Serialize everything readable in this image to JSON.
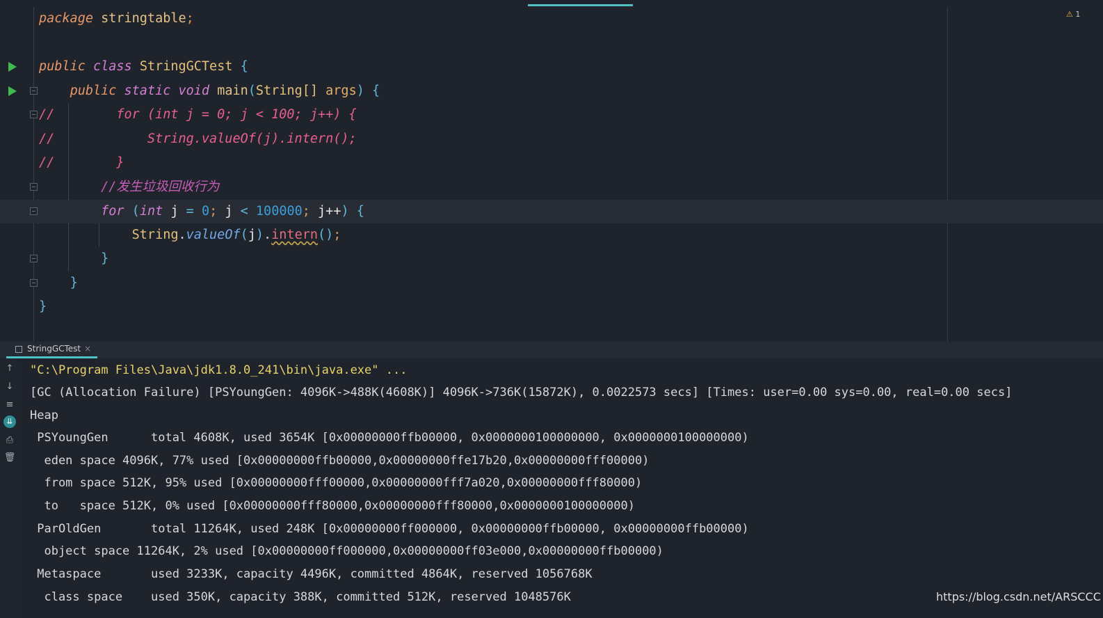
{
  "window": {
    "warning_count": "1"
  },
  "editor": {
    "package_kw": "package",
    "package_name": "stringtable",
    "line3": {
      "public": "public",
      "class": "class",
      "name": "StringGCTest",
      "brace": "{"
    },
    "line4": {
      "public": "public",
      "static": "static",
      "void": "void",
      "method": "main",
      "type": "String[]",
      "param": "args"
    },
    "line5": "//        for (int j = 0; j < 100; j++) {",
    "line6": "//            String.valueOf(j).intern();",
    "line7": "//        }",
    "line8_comment": "//发生垃圾回收行为",
    "line9": {
      "for": "for",
      "int": "int",
      "var": "j",
      "eq": "=",
      "zero": "0",
      "cmp": "<",
      "limit": "100000",
      "inc": "j++"
    },
    "line10": {
      "cls": "String",
      "valueOf": "valueOf",
      "arg": "j",
      "intern": "intern"
    },
    "close_brace": "}"
  },
  "run_panel": {
    "tab_label": "StringGCTest",
    "close_glyph": "×",
    "tools": [
      "up-arrow-icon",
      "down-arrow-icon",
      "soft-wrap-icon",
      "scroll-to-end-icon",
      "print-icon",
      "trash-icon"
    ],
    "output": [
      "\"C:\\Program Files\\Java\\jdk1.8.0_241\\bin\\java.exe\" ...",
      "[GC (Allocation Failure) [PSYoungGen: 4096K->488K(4608K)] 4096K->736K(15872K), 0.0022573 secs] [Times: user=0.00 sys=0.00, real=0.00 secs]",
      "Heap",
      " PSYoungGen      total 4608K, used 3654K [0x00000000ffb00000, 0x0000000100000000, 0x0000000100000000)",
      "  eden space 4096K, 77% used [0x00000000ffb00000,0x00000000ffe17b20,0x00000000fff00000)",
      "  from space 512K, 95% used [0x00000000fff00000,0x00000000fff7a020,0x00000000fff80000)",
      "  to   space 512K, 0% used [0x00000000fff80000,0x00000000fff80000,0x0000000100000000)",
      " ParOldGen       total 11264K, used 248K [0x00000000ff000000, 0x00000000ffb00000, 0x00000000ffb00000)",
      "  object space 11264K, 2% used [0x00000000ff000000,0x00000000ff03e000,0x00000000ffb00000)",
      " Metaspace       used 3233K, capacity 4496K, committed 4864K, reserved 1056768K",
      "  class space    used 350K, capacity 388K, committed 512K, reserved 1048576K"
    ]
  },
  "watermark": "https://blog.csdn.net/ARSCCC",
  "colors": {
    "accent": "#4fc0c4",
    "run_green": "#3fb950",
    "keyword": "#d37fd4",
    "comment": "#e85f93",
    "number": "#3d9ed8"
  }
}
